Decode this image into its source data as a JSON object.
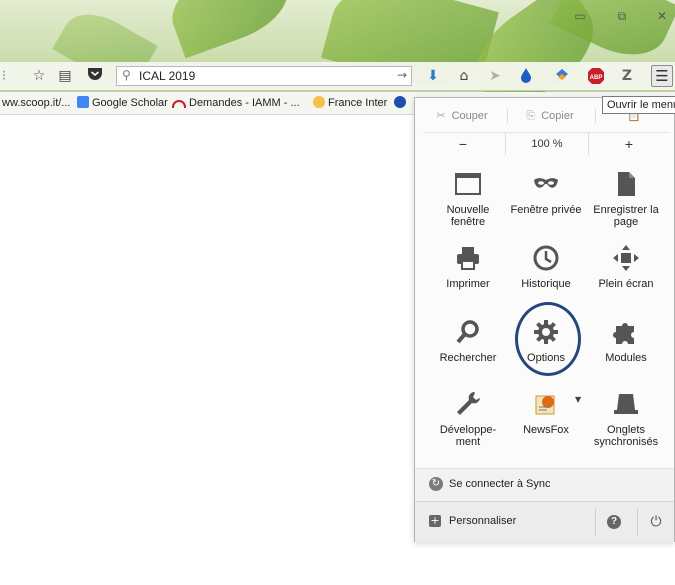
{
  "window": {
    "minimize_icon": "minimize-icon",
    "restore_icon": "restore-icon",
    "close_icon": "close-icon"
  },
  "toolbar": {
    "search_value": "ICAL 2019",
    "menu_tooltip": "Ouvrir le menu"
  },
  "bookmarks": [
    {
      "label": "ww.scoop.it/..."
    },
    {
      "label": "Google Scholar"
    },
    {
      "label": "Demandes - IAMM - ..."
    },
    {
      "label": "France Inter"
    }
  ],
  "menu_panel": {
    "edit": {
      "cut": "Couper",
      "copy": "Copier"
    },
    "zoom": {
      "minus": "−",
      "level": "100 %",
      "plus": "+"
    },
    "items": [
      {
        "label_l1": "Nouvelle",
        "label_l2": "fenêtre",
        "icon": "new-window-icon"
      },
      {
        "label_l1": "Fenêtre privée",
        "label_l2": "",
        "icon": "private-mask-icon"
      },
      {
        "label_l1": "Enregistrer la",
        "label_l2": "page",
        "icon": "save-page-icon"
      },
      {
        "label_l1": "Imprimer",
        "label_l2": "",
        "icon": "printer-icon"
      },
      {
        "label_l1": "Historique",
        "label_l2": "",
        "icon": "clock-icon"
      },
      {
        "label_l1": "Plein écran",
        "label_l2": "",
        "icon": "fullscreen-icon"
      },
      {
        "label_l1": "Rechercher",
        "label_l2": "",
        "icon": "magnifier-icon"
      },
      {
        "label_l1": "Options",
        "label_l2": "",
        "icon": "gear-icon"
      },
      {
        "label_l1": "Modules",
        "label_l2": "",
        "icon": "puzzle-icon"
      },
      {
        "label_l1": "Développe-",
        "label_l2": "ment",
        "icon": "wrench-icon"
      },
      {
        "label_l1": "NewsFox",
        "label_l2": "",
        "icon": "newsfox-icon"
      },
      {
        "label_l1": "Onglets",
        "label_l2": "synchronisés",
        "icon": "synced-tabs-icon"
      }
    ],
    "sync": "Se connecter à Sync",
    "customize": "Personnaliser"
  },
  "colors": {
    "annotation_circle": "#25477a",
    "download_arrow": "#2a78c8",
    "abp_red": "#c8202a"
  }
}
